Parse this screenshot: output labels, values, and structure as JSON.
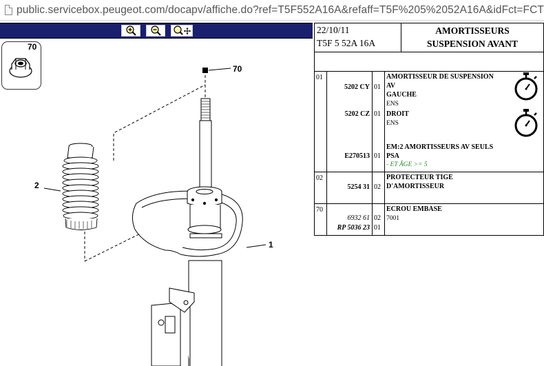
{
  "browser": {
    "url": "public.servicebox.peugeot.com/docapv/affiche.do?ref=T5F552A16A&refaff=T5F%205%2052A16A&idFct=FCT"
  },
  "diagram": {
    "toolbar": {
      "zoom_in": "zoom-in-icon",
      "zoom_out": "zoom-out-icon",
      "zoom_move": "zoom-move-icon"
    },
    "thumbnail_label": "70",
    "callouts": {
      "c70": "70",
      "c2": "2",
      "c1": "1"
    }
  },
  "header": {
    "date": "22/10/11",
    "reference": "T5F 5 52A 16A",
    "title_line1": "AMORTISSEURS",
    "title_line2": "SUSPENSION AVANT"
  },
  "parts": [
    {
      "ref": "01",
      "rows": [
        {
          "part": "5202 CY",
          "qty": "01",
          "desc": [
            "AMORTISSEUR DE SUSPENSION",
            "AV",
            "GAUCHE"
          ],
          "sub": "ENS"
        },
        {
          "part": "5202 CZ",
          "qty": "01",
          "desc": [
            "DROIT"
          ],
          "sub": "ENS"
        },
        {
          "part": "E270513",
          "qty": "01",
          "desc": [
            "EM:2 AMORTISSEURS AV SEULS",
            "PSA"
          ],
          "sub": "- ET ÂGE >= 5"
        }
      ]
    },
    {
      "ref": "02",
      "rows": [
        {
          "part": "5254 31",
          "qty": "02",
          "desc": [
            "PROTECTEUR TIGE",
            "D'AMORTISSEUR"
          ]
        }
      ]
    },
    {
      "ref": "70",
      "rows": [
        {
          "part": "6932 61",
          "qty": "02",
          "desc": [
            "ECROU EMBASE"
          ],
          "sub": "7001"
        },
        {
          "part": "RP 5036 23",
          "qty": "01"
        }
      ]
    }
  ],
  "icons": {
    "labour_time": "stopwatch-icon"
  }
}
